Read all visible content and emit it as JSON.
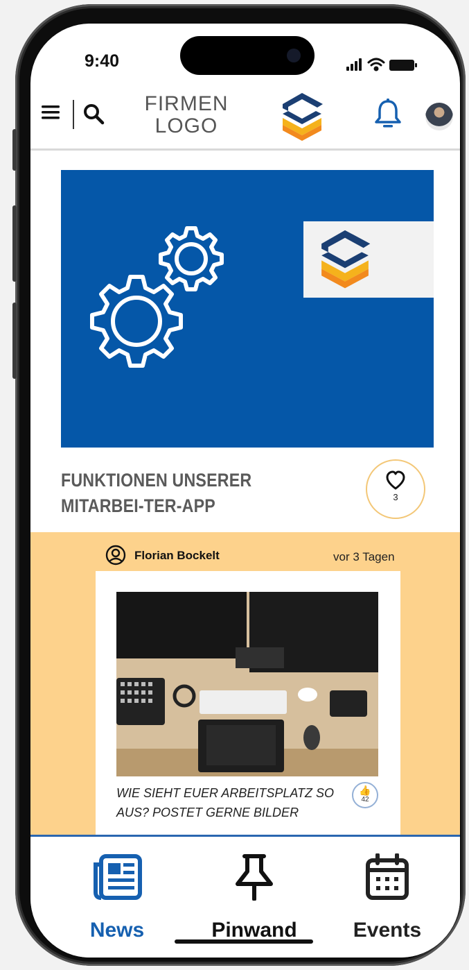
{
  "status_bar": {
    "time": "9:40"
  },
  "header": {
    "menu_icon": "menu-icon",
    "search_icon": "search-icon",
    "logo_line1": "FIRMEN",
    "logo_line2": "LOGO",
    "notification_icon": "bell-icon",
    "avatar": "user-avatar"
  },
  "featured_post": {
    "title": "FUNKTIONEN UNSERER MITARBEI-TER-APP",
    "likes": "3",
    "banner_color": "#0557a8"
  },
  "feed_post": {
    "author": "Florian Bockelt",
    "time_ago": "vor 3 Tagen",
    "text": "WIE SIEHT EUER ARBEITSPLATZ SO AUS? POSTET GERNE BILDER",
    "likes": "42",
    "background": "#fdd28c"
  },
  "tabbar": {
    "tabs": [
      {
        "label": "News",
        "icon": "newspaper-icon",
        "active": true
      },
      {
        "label": "Pinwand",
        "icon": "pin-icon",
        "active": false
      },
      {
        "label": "Events",
        "icon": "calendar-icon",
        "active": false
      }
    ],
    "active_color": "#1660b0"
  },
  "colors": {
    "brand_blue": "#1b3f73",
    "brand_orange": "#f28a1e",
    "brand_yellow": "#f5b21c",
    "accent_blue": "#1660b0"
  }
}
